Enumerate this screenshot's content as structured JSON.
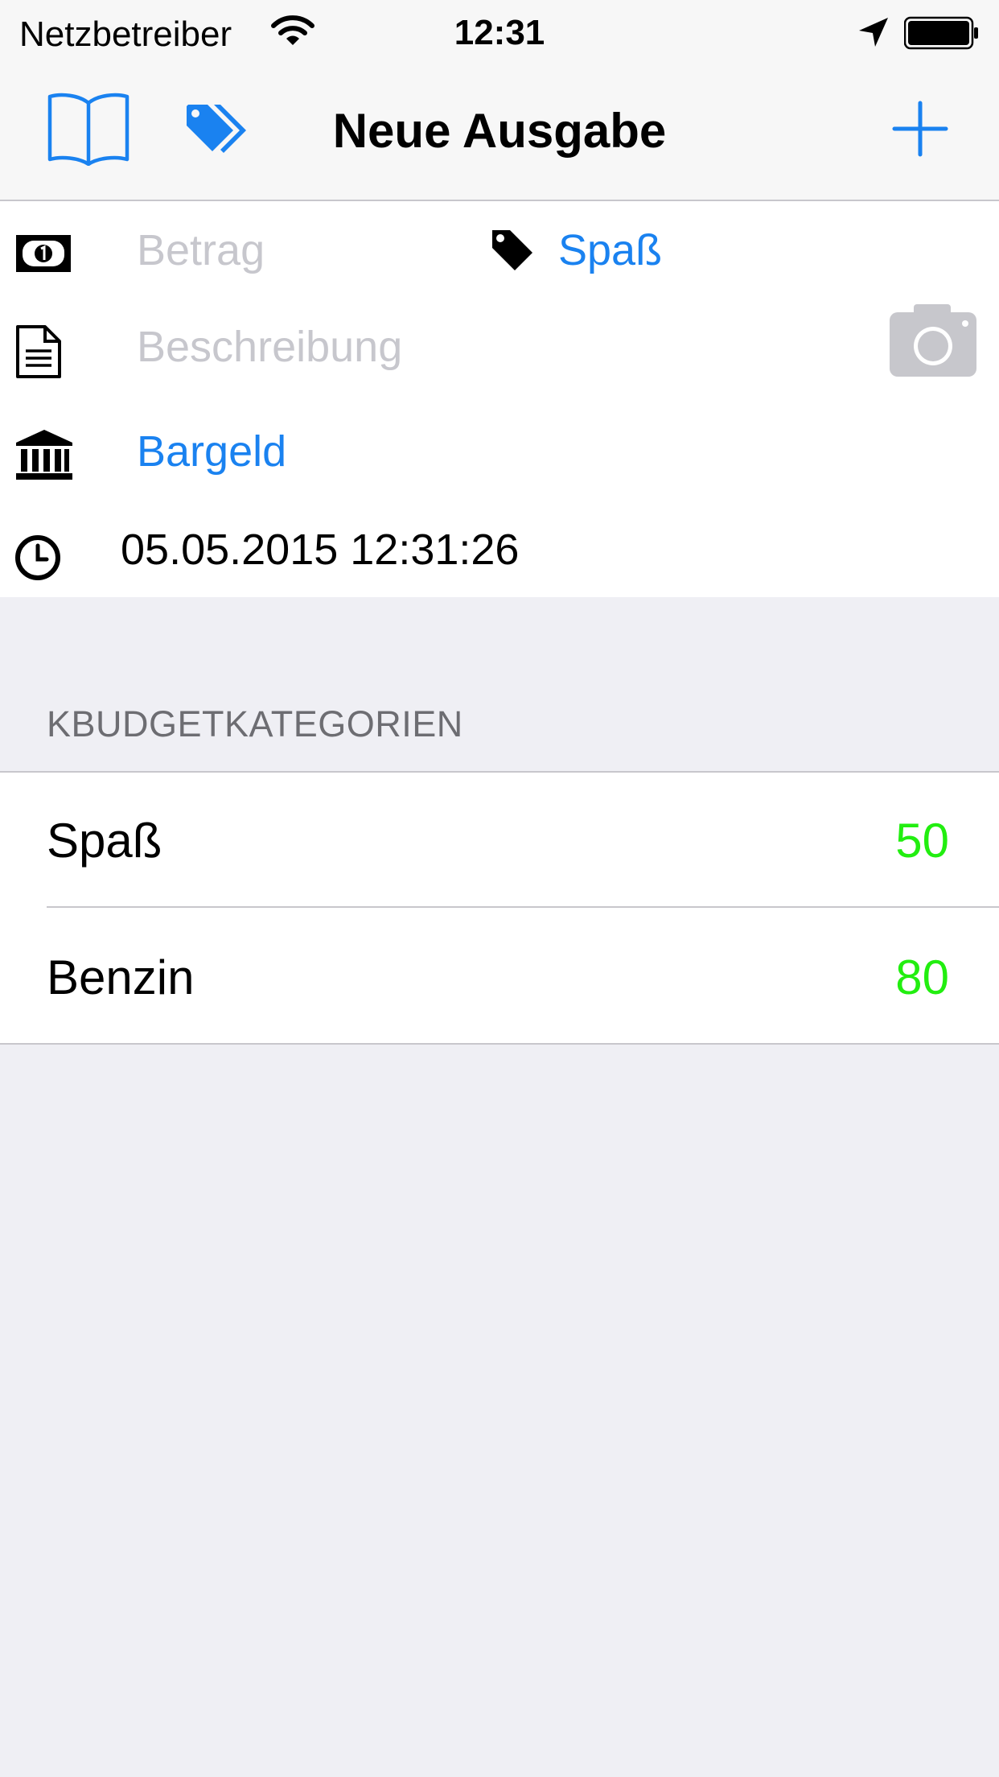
{
  "status_bar": {
    "carrier": "Netzbetreiber",
    "time": "12:31",
    "icons": [
      "wifi-icon",
      "location-arrow-icon",
      "battery-icon"
    ]
  },
  "nav": {
    "title": "Neue Ausgabe",
    "left_icons": [
      "book-icon",
      "tags-icon"
    ],
    "right_icon": "plus-icon"
  },
  "form": {
    "amount_placeholder": "Betrag",
    "category_value": "Spaß",
    "description_placeholder": "Beschreibung",
    "account_value": "Bargeld",
    "datetime_value": "05.05.2015 12:31:26",
    "icons": [
      "money-icon",
      "tag-icon",
      "document-icon",
      "camera-icon",
      "bank-icon",
      "clock-icon"
    ]
  },
  "budget_section": {
    "header": "KBUDGETKATEGORIEN",
    "rows": [
      {
        "label": "Spaß",
        "value": "50"
      },
      {
        "label": "Benzin",
        "value": "80"
      }
    ]
  },
  "colors": {
    "accent": "#1a82f0",
    "positive": "#22ee10",
    "placeholder": "#c7c7cd",
    "background": "#efeff4"
  }
}
